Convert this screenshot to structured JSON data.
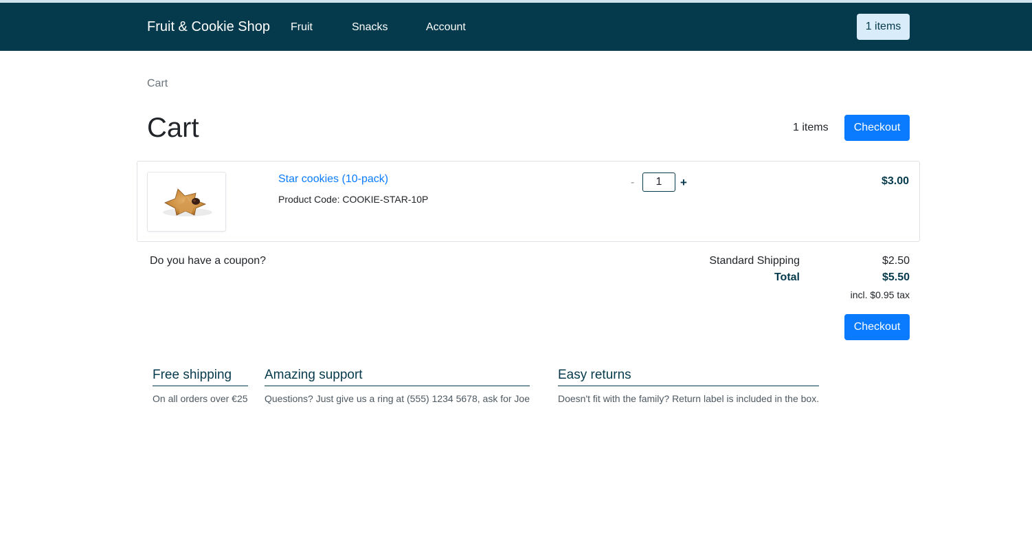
{
  "navbar": {
    "brand": "Fruit & Cookie Shop",
    "links": [
      "Fruit",
      "Snacks",
      "Account"
    ],
    "cart_badge": "1 items"
  },
  "breadcrumb": "Cart",
  "page": {
    "title": "Cart",
    "items_count": "1 items",
    "checkout_label": "Checkout"
  },
  "cart": {
    "items": [
      {
        "name": "Star cookies (10-pack)",
        "code_label": "Product Code: COOKIE-STAR-10P",
        "qty_minus": "-",
        "quantity": "1",
        "qty_plus": "+",
        "price": "$3.00",
        "image_icon": "star-cookie-image"
      }
    ]
  },
  "coupon_prompt": "Do you have a coupon?",
  "summary": {
    "shipping_label": "Standard Shipping",
    "shipping_value": "$2.50",
    "total_label": "Total",
    "total_value": "$5.50",
    "tax_note": "incl. $0.95 tax"
  },
  "features": [
    {
      "title": "Free shipping",
      "text": "On all orders over €25"
    },
    {
      "title": "Amazing support",
      "text": "Questions? Just give us a ring at (555) 1234 5678, ask for Joe"
    },
    {
      "title": "Easy returns",
      "text": "Doesn't fit with the family? Return label is included in the box."
    }
  ],
  "colors": {
    "navbar": "#053a4c",
    "primary": "#0a7bff",
    "badge": "#d8edf9"
  }
}
